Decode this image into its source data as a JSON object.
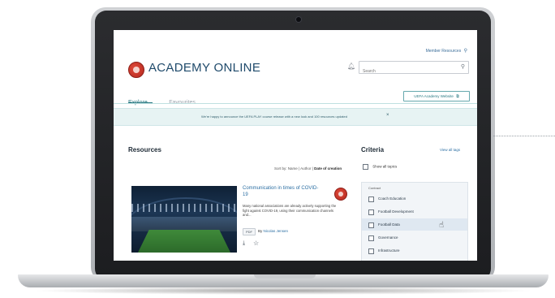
{
  "header": {
    "member_link": "Member Resources",
    "app_title": "ACADEMY ONLINE",
    "search_placeholder": "Search"
  },
  "tabs": [
    {
      "label": "Explore"
    },
    {
      "label": "Favourites"
    }
  ],
  "visit_button": "UEFA Academy Website",
  "banner": {
    "text": "We're happy to announce the UEFA PLAY course release with a new look and 100 resources updated"
  },
  "resources": {
    "title": "Resources",
    "sort": {
      "prefix": "Sort by: Name | Author |",
      "active": "Date of creation"
    },
    "card": {
      "title": "Communication in times of COVID-19",
      "description": "Many national associations are already actively supporting the fight against COVID-19, using their communication channels and...",
      "pill": "PDF",
      "author_prefix": "By",
      "author": "Nicolas Jensen"
    }
  },
  "criteria": {
    "title": "Criteria",
    "view_all": "View all tags",
    "show_all": "Show all topics",
    "topics_header": "Contract",
    "topics": [
      {
        "label": "Coach Education"
      },
      {
        "label": "Football Development"
      },
      {
        "label": "Football Data"
      },
      {
        "label": "Governance"
      },
      {
        "label": "Infrastructure"
      }
    ]
  }
}
